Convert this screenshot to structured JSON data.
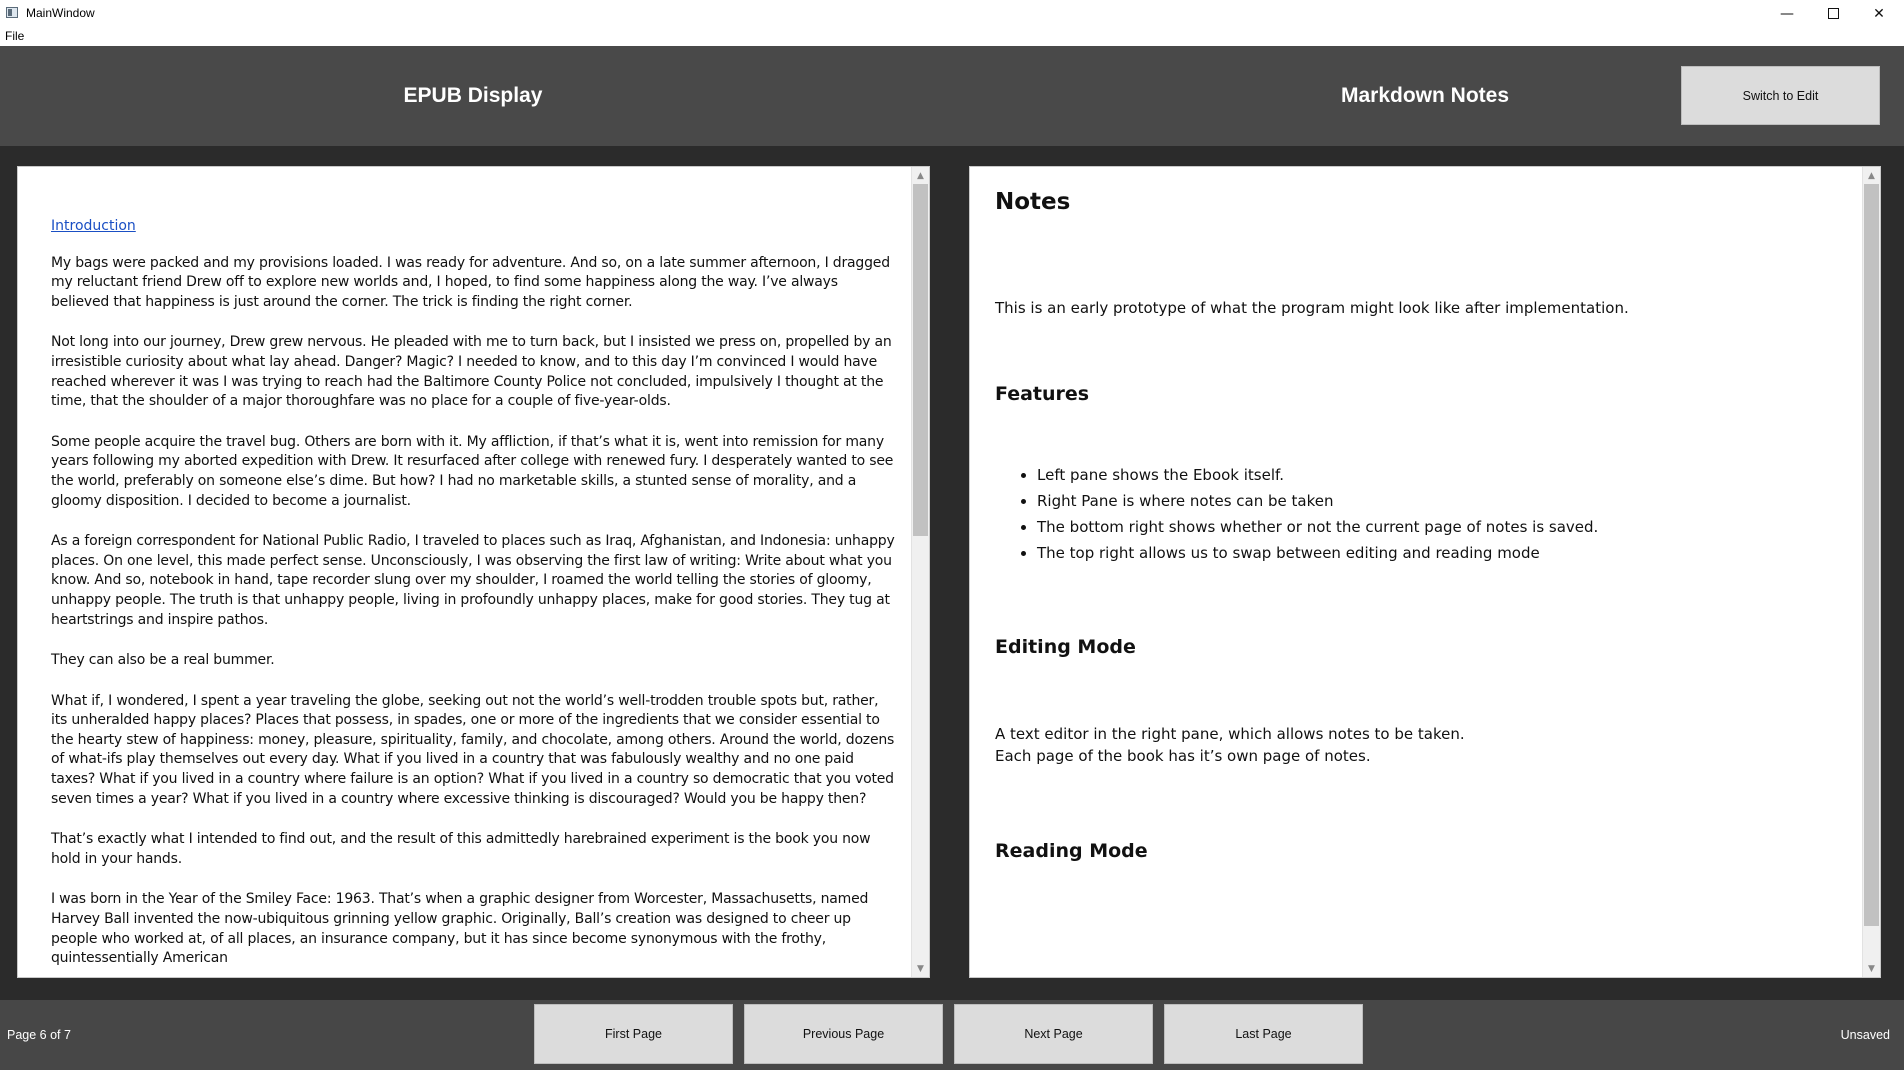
{
  "window": {
    "title": "MainWindow",
    "min_glyph": "—",
    "close_glyph": "✕"
  },
  "menubar": {
    "file": "File"
  },
  "header": {
    "epub_title": "EPUB Display",
    "notes_title": "Markdown Notes",
    "switch_label": "Switch to Edit"
  },
  "epub": {
    "link": "Introduction",
    "paragraphs": [
      "My bags were packed and my provisions loaded. I was ready for adventure. And so, on a late summer afternoon, I dragged my reluctant friend Drew off to explore new worlds and, I hoped, to find some happiness along the way. I’ve always believed that happiness is just around the corner. The trick is finding the right corner.",
      "Not long into our journey, Drew grew nervous. He pleaded with me to turn back, but I insisted we press on, propelled by an irresistible curiosity about what lay ahead. Danger? Magic? I needed to know, and to this day I’m convinced I would have reached wherever it was I was trying to reach had the Baltimore County Police not concluded, impulsively I thought at the time, that the shoulder of a major thoroughfare was no place for a couple of five-year-olds.",
      "Some people acquire the travel bug. Others are born with it. My affliction, if that’s what it is, went into remission for many years following my aborted expedition with Drew. It resurfaced after college with renewed fury. I desperately wanted to see the world, preferably on someone else’s dime. But how? I had no marketable skills, a stunted sense of morality, and a gloomy disposition. I decided to become a journalist.",
      "As a foreign correspondent for National Public Radio, I traveled to places such as Iraq, Afghanistan, and Indonesia: unhappy places. On one level, this made perfect sense. Unconsciously, I was observing the first law of writing: Write about what you know. And so, notebook in hand, tape recorder slung over my shoulder, I roamed the world telling the stories of gloomy, unhappy people. The truth is that unhappy people, living in profoundly unhappy places, make for good stories. They tug at heartstrings and inspire pathos.",
      "They can also be a real bummer.",
      "What if, I wondered, I spent a year traveling the globe, seeking out not the world’s well-trodden trouble spots but, rather, its unheralded happy places? Places that possess, in spades, one or more of the ingredients that we consider essential to the hearty stew of happiness: money, pleasure, spirituality, family, and chocolate, among others. Around the world, dozens of what-ifs play themselves out every day. What if you lived in a country that was fabulously wealthy and no one paid taxes? What if you lived in a country where failure is an option? What if you lived in a country so democratic that you voted seven times a year? What if you lived in a country where excessive thinking is discouraged? Would you be happy then?",
      "That’s exactly what I intended to find out, and the result of this admittedly harebrained experiment is the book you now hold in your hands.",
      "I was born in the Year of the Smiley Face: 1963. That’s when a graphic designer from Worcester, Massachusetts, named Harvey Ball invented the now-ubiquitous grinning yellow graphic. Originally, Ball’s creation was designed to cheer up people who worked at, of all places, an insurance company, but it has since become synonymous with the frothy, quintessentially American"
    ]
  },
  "notes": {
    "heading": "Notes",
    "intro": "This is an early prototype of what the program might look like after implementation.",
    "features_heading": "Features",
    "features": [
      "Left pane shows the Ebook itself.",
      "Right Pane is where notes can be taken",
      "The bottom right shows whether or not the current page of notes is saved.",
      "The top right allows us to swap between editing and reading mode"
    ],
    "editing_heading": "Editing Mode",
    "editing_line1": "A text editor in the right pane, which allows notes to be taken.",
    "editing_line2": "Each page of the book has it’s own page of notes.",
    "reading_heading": "Reading Mode"
  },
  "footer": {
    "page_indicator": "Page 6 of 7",
    "first": "First Page",
    "previous": "Previous Page",
    "next": "Next Page",
    "last": "Last Page",
    "status": "Unsaved"
  }
}
